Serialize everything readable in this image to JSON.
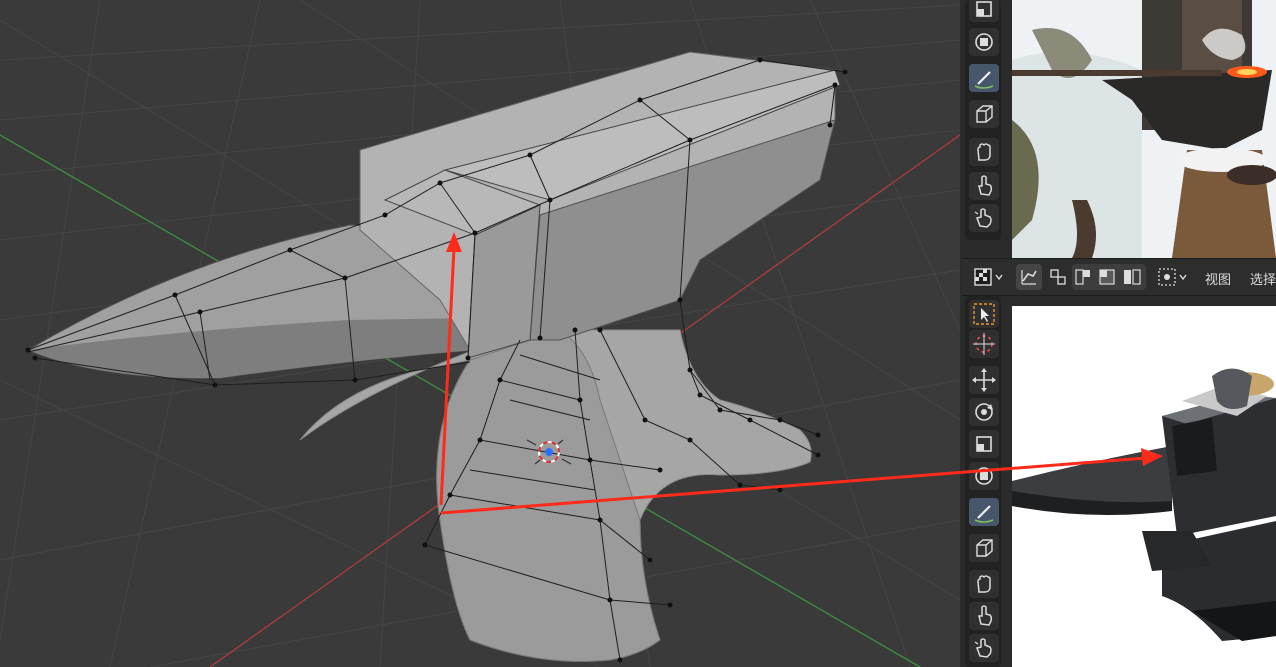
{
  "header_menu": {
    "view_label": "视图",
    "select_label": "选择"
  },
  "colors": {
    "viewport_bg": "#3a3a3a",
    "grid_line": "#454545",
    "axis_x_red": "#b03c3c",
    "axis_y_green": "#3f8f3f",
    "mesh_gray": "#a4a4a4",
    "annotation_arrow": "#ff2b1a",
    "panel_bg": "#2b2b2b",
    "active_tool": "#47566a",
    "select_highlight": "#e69a2e"
  },
  "top_toolbar_tools": [
    "scale-tool-icon",
    "transform-tool-icon",
    "annotate-tool-icon",
    "add-cube-tool-icon",
    "grab-hand-icon",
    "pointer-hand-icon",
    "pinch-hand-icon"
  ],
  "bottom_toolbar_tools": [
    "select-box-tool-icon",
    "cursor-tool-icon",
    "move-tool-icon",
    "rotate-tool-icon",
    "scale-tool-icon",
    "transform-tool-icon",
    "annotate-tool-icon",
    "add-cube-tool-icon",
    "grab-hand-icon",
    "pointer-hand-icon",
    "pinch-hand-icon"
  ],
  "header_icons": [
    "image-editor-type-icon",
    "sync-toggle-icon",
    "display-channel-icon",
    "display-single-icon",
    "display-color-icon",
    "display-alpha-icon",
    "uv-mode-icon"
  ]
}
